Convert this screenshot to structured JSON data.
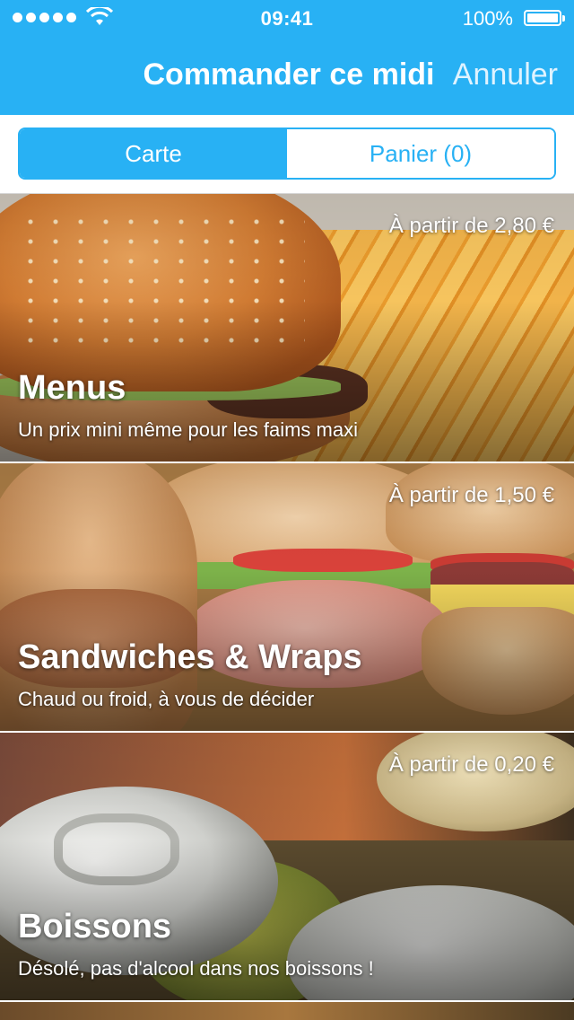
{
  "status_bar": {
    "time": "09:41",
    "battery": "100%"
  },
  "nav": {
    "title": "Commander ce midi",
    "cancel_label": "Annuler"
  },
  "segments": [
    {
      "label": "Carte",
      "active": true
    },
    {
      "label": "Panier (0)",
      "active": false
    }
  ],
  "categories": [
    {
      "title": "Menus",
      "subtitle": "Un prix mini même pour les faims maxi",
      "price": "À partir de 2,80 €"
    },
    {
      "title": "Sandwiches & Wraps",
      "subtitle": "Chaud ou froid, à vous de décider",
      "price": "À partir de 1,50 €"
    },
    {
      "title": "Boissons",
      "subtitle": "Désolé, pas d'alcool dans nos boissons !",
      "price": "À partir de 0,20 €"
    }
  ],
  "colors": {
    "accent": "#28b1f4"
  }
}
